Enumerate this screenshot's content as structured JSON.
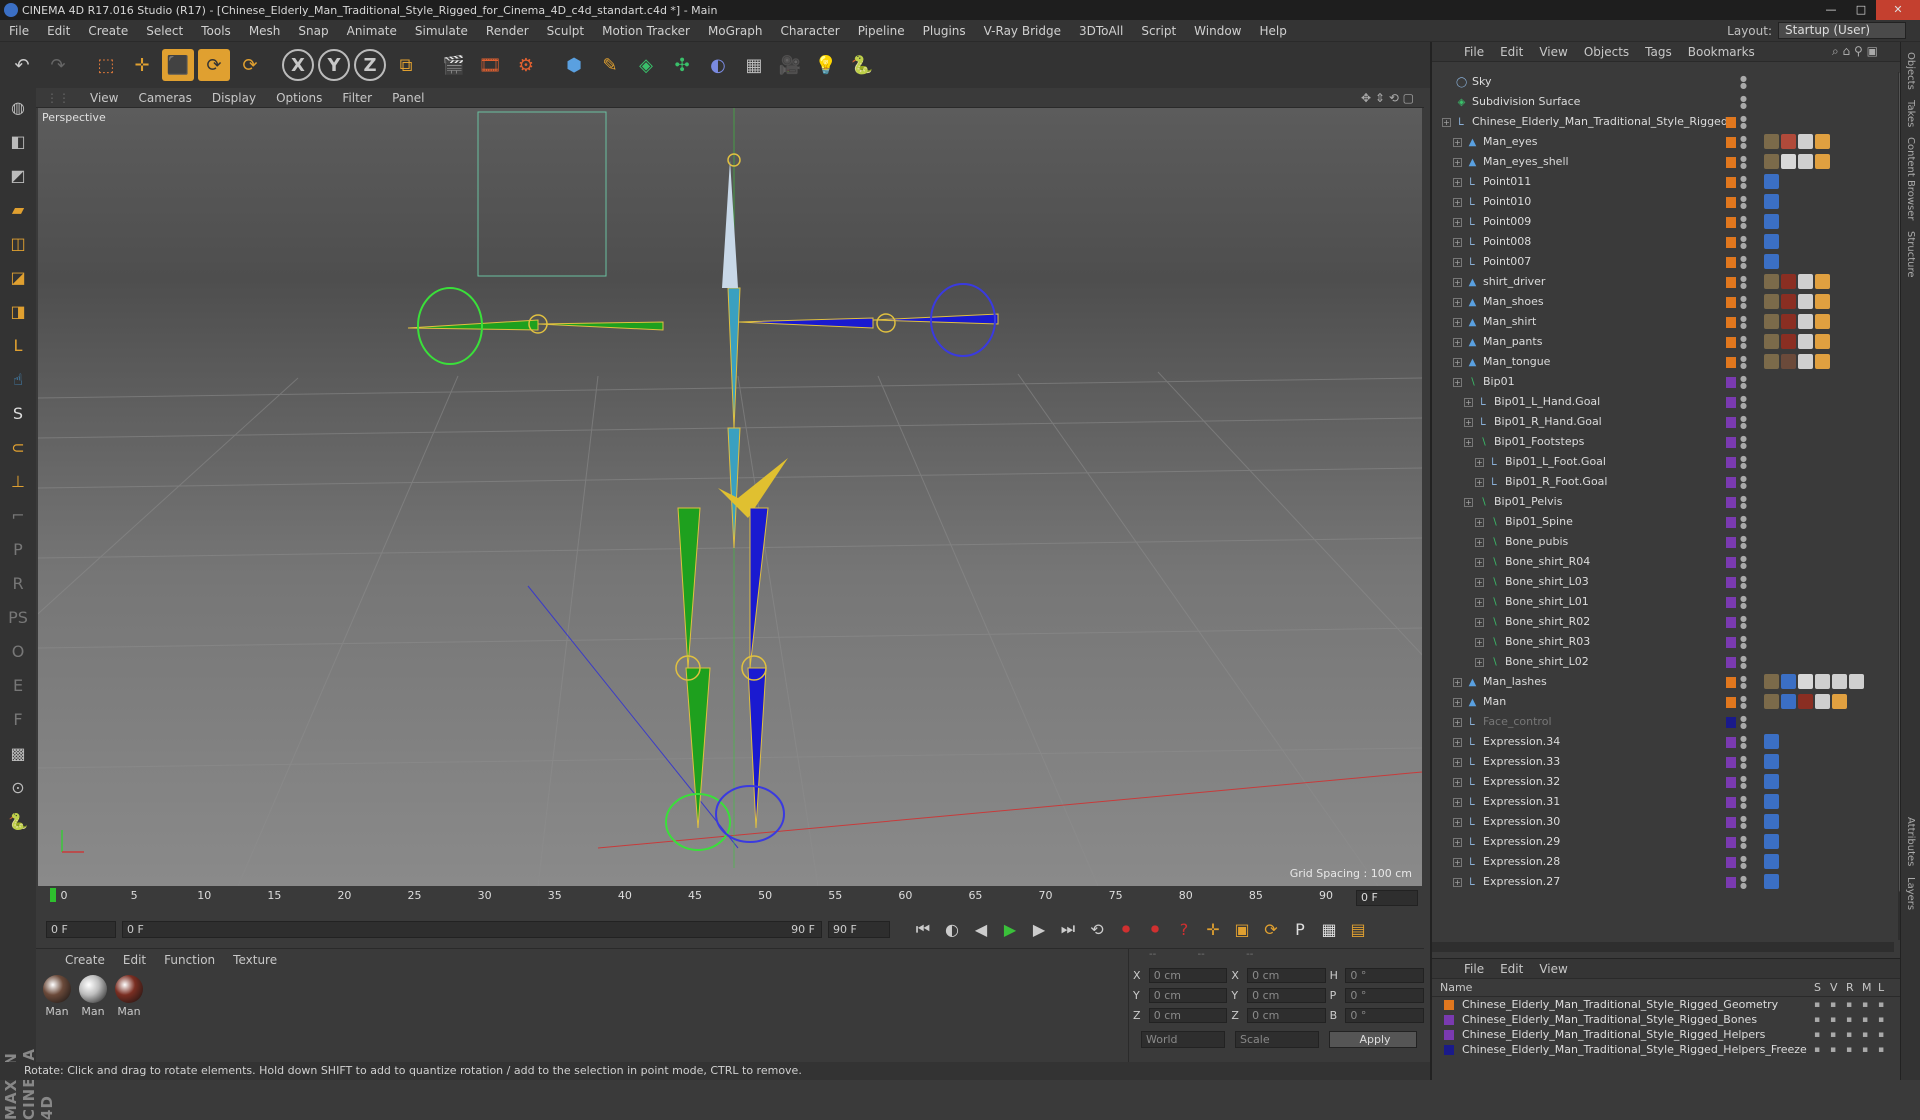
{
  "window": {
    "title": "CINEMA 4D R17.016 Studio (R17) - [Chinese_Elderly_Man_Traditional_Style_Rigged_for_Cinema_4D_c4d_standart.c4d *] - Main"
  },
  "menubar": {
    "items": [
      "File",
      "Edit",
      "Create",
      "Select",
      "Tools",
      "Mesh",
      "Snap",
      "Animate",
      "Simulate",
      "Render",
      "Sculpt",
      "Motion Tracker",
      "MoGraph",
      "Character",
      "Pipeline",
      "Plugins",
      "V-Ray Bridge",
      "3DToAll",
      "Script",
      "Window",
      "Help"
    ],
    "layout_label": "Layout:",
    "layout_value": "Startup (User)"
  },
  "viewport": {
    "menu": [
      "View",
      "Cameras",
      "Display",
      "Options",
      "Filter",
      "Panel"
    ],
    "label": "Perspective",
    "grid_spacing": "Grid Spacing : 100 cm"
  },
  "timeline": {
    "ticks": [
      "0",
      "5",
      "10",
      "15",
      "20",
      "25",
      "30",
      "35",
      "40",
      "45",
      "50",
      "55",
      "60",
      "65",
      "70",
      "75",
      "80",
      "85",
      "90"
    ],
    "frame_right": "0 F",
    "start": "0 F",
    "scrub_start": "0 F",
    "scrub_end": "90 F",
    "end": "90 F"
  },
  "materials": {
    "menu": [
      "Create",
      "Edit",
      "Function",
      "Texture"
    ],
    "items": [
      {
        "label": "Man",
        "color": "#6b4a3a"
      },
      {
        "label": "Man",
        "color": "#bdbdbd"
      },
      {
        "label": "Man",
        "color": "#7a2e22"
      }
    ]
  },
  "coords": {
    "rows": [
      {
        "a": "X",
        "av": "0 cm",
        "b": "X",
        "bv": "0 cm",
        "c": "H",
        "cv": "0 °"
      },
      {
        "a": "Y",
        "av": "0 cm",
        "b": "Y",
        "bv": "0 cm",
        "c": "P",
        "cv": "0 °"
      },
      {
        "a": "Z",
        "av": "0 cm",
        "b": "Z",
        "bv": "0 cm",
        "c": "B",
        "cv": "0 °"
      }
    ],
    "world": "World",
    "scale": "Scale",
    "apply": "Apply"
  },
  "status": "Rotate: Click and drag to rotate elements. Hold down SHIFT to add to quantize rotation / add to the selection in point mode, CTRL to remove.",
  "object_manager": {
    "menu": [
      "File",
      "Edit",
      "View",
      "Objects",
      "Tags",
      "Bookmarks"
    ],
    "rows": [
      {
        "name": "Sky",
        "depth": 0,
        "icon": "sky",
        "layer": "",
        "tags": []
      },
      {
        "name": "Subdivision Surface",
        "depth": 0,
        "icon": "subd",
        "layer": "",
        "tags": []
      },
      {
        "name": "Chinese_Elderly_Man_Traditional_Style_Rigged",
        "depth": 0,
        "icon": "null",
        "layer": "#e0771e",
        "tags": []
      },
      {
        "name": "Man_eyes",
        "depth": 1,
        "icon": "poly",
        "layer": "#e0771e",
        "tags": [
          "#7b6a4a",
          "#b04a3a",
          "#cfcfcf",
          "#e0a040"
        ]
      },
      {
        "name": "Man_eyes_shell",
        "depth": 1,
        "icon": "poly",
        "layer": "#e0771e",
        "tags": [
          "#7b6a4a",
          "#d8d8d8",
          "#cfcfcf",
          "#e0a040"
        ]
      },
      {
        "name": "Point011",
        "depth": 1,
        "icon": "null",
        "layer": "#e0771e",
        "tags": [
          "#3b6fc4"
        ]
      },
      {
        "name": "Point010",
        "depth": 1,
        "icon": "null",
        "layer": "#e0771e",
        "tags": [
          "#3b6fc4"
        ]
      },
      {
        "name": "Point009",
        "depth": 1,
        "icon": "null",
        "layer": "#e0771e",
        "tags": [
          "#3b6fc4"
        ]
      },
      {
        "name": "Point008",
        "depth": 1,
        "icon": "null",
        "layer": "#e0771e",
        "tags": [
          "#3b6fc4"
        ]
      },
      {
        "name": "Point007",
        "depth": 1,
        "icon": "null",
        "layer": "#e0771e",
        "tags": [
          "#3b6fc4"
        ]
      },
      {
        "name": "shirt_driver",
        "depth": 1,
        "icon": "poly",
        "layer": "#e0771e",
        "tags": [
          "#7b6a4a",
          "#8a2e22",
          "#cfcfcf",
          "#e0a040"
        ]
      },
      {
        "name": "Man_shoes",
        "depth": 1,
        "icon": "poly",
        "layer": "#e0771e",
        "tags": [
          "#7b6a4a",
          "#8a2e22",
          "#cfcfcf",
          "#e0a040"
        ]
      },
      {
        "name": "Man_shirt",
        "depth": 1,
        "icon": "poly",
        "layer": "#e0771e",
        "tags": [
          "#7b6a4a",
          "#8a2e22",
          "#cfcfcf",
          "#e0a040"
        ]
      },
      {
        "name": "Man_pants",
        "depth": 1,
        "icon": "poly",
        "layer": "#e0771e",
        "tags": [
          "#7b6a4a",
          "#8a2e22",
          "#cfcfcf",
          "#e0a040"
        ]
      },
      {
        "name": "Man_tongue",
        "depth": 1,
        "icon": "poly",
        "layer": "#e0771e",
        "tags": [
          "#7b6a4a",
          "#6b4a3a",
          "#cfcfcf",
          "#e0a040"
        ]
      },
      {
        "name": "Bip01",
        "depth": 1,
        "icon": "bone",
        "layer": "#7a3ab0",
        "tags": []
      },
      {
        "name": "Bip01_L_Hand.Goal",
        "depth": 2,
        "icon": "null",
        "layer": "#7a3ab0",
        "tags": []
      },
      {
        "name": "Bip01_R_Hand.Goal",
        "depth": 2,
        "icon": "null",
        "layer": "#7a3ab0",
        "tags": []
      },
      {
        "name": "Bip01_Footsteps",
        "depth": 2,
        "icon": "bone",
        "layer": "#7a3ab0",
        "tags": []
      },
      {
        "name": "Bip01_L_Foot.Goal",
        "depth": 3,
        "icon": "null",
        "layer": "#7a3ab0",
        "tags": []
      },
      {
        "name": "Bip01_R_Foot.Goal",
        "depth": 3,
        "icon": "null",
        "layer": "#7a3ab0",
        "tags": []
      },
      {
        "name": "Bip01_Pelvis",
        "depth": 2,
        "icon": "bone",
        "layer": "#7a3ab0",
        "tags": []
      },
      {
        "name": "Bip01_Spine",
        "depth": 3,
        "icon": "bone",
        "layer": "#7a3ab0",
        "tags": []
      },
      {
        "name": "Bone_pubis",
        "depth": 3,
        "icon": "bone",
        "layer": "#7a3ab0",
        "tags": []
      },
      {
        "name": "Bone_shirt_R04",
        "depth": 3,
        "icon": "bone",
        "layer": "#7a3ab0",
        "tags": []
      },
      {
        "name": "Bone_shirt_L03",
        "depth": 3,
        "icon": "bone",
        "layer": "#7a3ab0",
        "tags": []
      },
      {
        "name": "Bone_shirt_L01",
        "depth": 3,
        "icon": "bone",
        "layer": "#7a3ab0",
        "tags": []
      },
      {
        "name": "Bone_shirt_R02",
        "depth": 3,
        "icon": "bone",
        "layer": "#7a3ab0",
        "tags": []
      },
      {
        "name": "Bone_shirt_R03",
        "depth": 3,
        "icon": "bone",
        "layer": "#7a3ab0",
        "tags": []
      },
      {
        "name": "Bone_shirt_L02",
        "depth": 3,
        "icon": "bone",
        "layer": "#7a3ab0",
        "tags": []
      },
      {
        "name": "Man_lashes",
        "depth": 1,
        "icon": "poly",
        "layer": "#e0771e",
        "tags": [
          "#7b6a4a",
          "#3b6fc4",
          "#d8d8d8",
          "#cfcfcf",
          "#cfcfcf",
          "#cfcfcf"
        ]
      },
      {
        "name": "Man",
        "depth": 1,
        "icon": "poly",
        "layer": "#e0771e",
        "tags": [
          "#7b6a4a",
          "#3b6fc4",
          "#8a2e22",
          "#cfcfcf",
          "#e0a040"
        ]
      },
      {
        "name": "Face_control",
        "depth": 1,
        "icon": "null",
        "layer": "#1a1a8a",
        "tags": [],
        "dim": true
      },
      {
        "name": "Expression.34",
        "depth": 1,
        "icon": "null",
        "layer": "#7a3ab0",
        "tags": [
          "#3b6fc4"
        ]
      },
      {
        "name": "Expression.33",
        "depth": 1,
        "icon": "null",
        "layer": "#7a3ab0",
        "tags": [
          "#3b6fc4"
        ]
      },
      {
        "name": "Expression.32",
        "depth": 1,
        "icon": "null",
        "layer": "#7a3ab0",
        "tags": [
          "#3b6fc4"
        ]
      },
      {
        "name": "Expression.31",
        "depth": 1,
        "icon": "null",
        "layer": "#7a3ab0",
        "tags": [
          "#3b6fc4"
        ]
      },
      {
        "name": "Expression.30",
        "depth": 1,
        "icon": "null",
        "layer": "#7a3ab0",
        "tags": [
          "#3b6fc4"
        ]
      },
      {
        "name": "Expression.29",
        "depth": 1,
        "icon": "null",
        "layer": "#7a3ab0",
        "tags": [
          "#3b6fc4"
        ]
      },
      {
        "name": "Expression.28",
        "depth": 1,
        "icon": "null",
        "layer": "#7a3ab0",
        "tags": [
          "#3b6fc4"
        ]
      },
      {
        "name": "Expression.27",
        "depth": 1,
        "icon": "null",
        "layer": "#7a3ab0",
        "tags": [
          "#3b6fc4"
        ]
      }
    ]
  },
  "layer_manager": {
    "menu": [
      "File",
      "Edit",
      "View"
    ],
    "header": {
      "name": "Name",
      "s": "S",
      "v": "V",
      "r": "R",
      "m": "M",
      "l": "L"
    },
    "rows": [
      {
        "name": "Chinese_Elderly_Man_Traditional_Style_Rigged_Geometry",
        "color": "#e0771e"
      },
      {
        "name": "Chinese_Elderly_Man_Traditional_Style_Rigged_Bones",
        "color": "#7a3ab0"
      },
      {
        "name": "Chinese_Elderly_Man_Traditional_Style_Rigged_Helpers",
        "color": "#7a3ab0"
      },
      {
        "name": "Chinese_Elderly_Man_Traditional_Style_Rigged_Helpers_Freeze",
        "color": "#1a1a8a"
      }
    ]
  },
  "side_tabs": [
    "Objects",
    "Takes",
    "Content Browser",
    "Structure"
  ],
  "side_tabs_lower": [
    "Attributes",
    "Layers"
  ],
  "brand": "MAXON CINEMA 4D"
}
